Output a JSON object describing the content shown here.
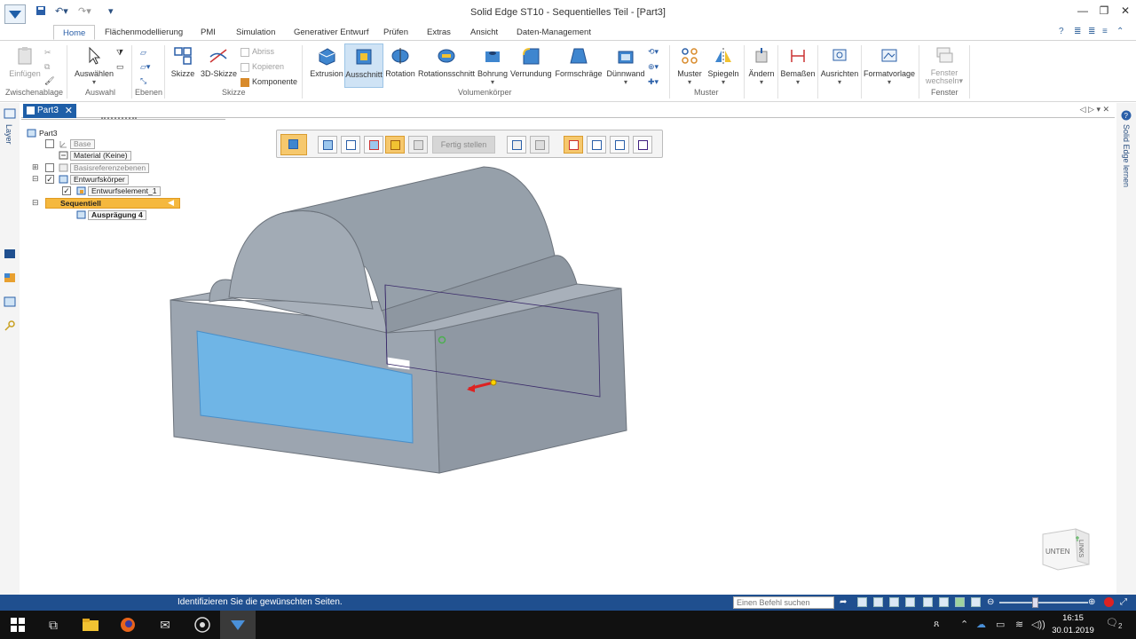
{
  "titlebar": {
    "title": "Solid Edge ST10 - Sequentielles Teil - [Part3]",
    "minimize": "—",
    "restore": "❐",
    "close": "✕",
    "qa_icons": [
      "save-icon",
      "undo-icon",
      "redo-icon",
      "customize-icon"
    ]
  },
  "menu": {
    "home": "Home",
    "flaechen": "Flächenmodellierung",
    "pmi": "PMI",
    "simulation": "Simulation",
    "generativ": "Generativer Entwurf",
    "pruefen": "Prüfen",
    "extras": "Extras",
    "ansicht": "Ansicht",
    "datenmgmt": "Daten-Management"
  },
  "ribbon": {
    "zwischenablage": {
      "einfuegen": "Einfügen",
      "group": "Zwischenablage"
    },
    "auswahl": {
      "auswaehlen": "Auswählen",
      "group": "Auswahl"
    },
    "ebenen": {
      "group": "Ebenen"
    },
    "skizze": {
      "skizze": "Skizze",
      "skizze3d": "3D-Skizze",
      "abriss": "Abriss",
      "kopieren": "Kopieren",
      "komponente": "Komponente",
      "group": "Skizze"
    },
    "volumen": {
      "extrusion": "Extrusion",
      "ausschnitt": "Ausschnitt",
      "rotation": "Rotation",
      "rotationsschnitt": "Rotationsschnitt",
      "bohrung": "Bohrung",
      "verrundung": "Verrundung",
      "formschraege": "Formschräge",
      "duennwand": "Dünnwand",
      "group": "Volumenkörper"
    },
    "muster": {
      "muster": "Muster",
      "spiegeln": "Spiegeln",
      "group": "Muster"
    },
    "aendern": {
      "aendern": "Ändern"
    },
    "bemassen": {
      "bemassen": "Bemaßen"
    },
    "ausrichten": {
      "ausrichten": "Ausrichten"
    },
    "formatvorlage": {
      "formatvorlage": "Formatvorlage"
    },
    "fenster": {
      "wechseln_1": "Fenster",
      "wechseln_2": "wechseln",
      "group": "Fenster"
    }
  },
  "doc_tab": {
    "label": "Part3",
    "close": "✕"
  },
  "tab_controls": "◁ ▷ ▾ ✕",
  "left_strip": {
    "layer": "Layer"
  },
  "right_strip": {
    "learn": "Solid Edge lernen"
  },
  "pathfinder": {
    "root": "Part3",
    "base": "Base",
    "material": "Material (Keine)",
    "basisref": "Basisreferenzebenen",
    "entwurfskoerper": "Entwurfskörper",
    "entwurfselement": "Entwurfselement_1",
    "sequentiell": "Sequentiell",
    "auspraegung": "Ausprägung 4"
  },
  "command_bar": {
    "fertig": "Fertig stellen"
  },
  "viewcube": {
    "unten": "UNTEN",
    "links": "LINKS"
  },
  "statusbar": {
    "message": "Identifizieren Sie die gewünschten Seiten.",
    "search_placeholder": "Einen Befehl suchen"
  },
  "taskbar": {
    "time": "16:15",
    "date": "30.01.2019",
    "notif": "2"
  },
  "colors": {
    "accent": "#1f4f8f",
    "highlight": "#f5b83e",
    "model_face": "#9aa3ad",
    "cut_face": "#6fb5e6"
  }
}
